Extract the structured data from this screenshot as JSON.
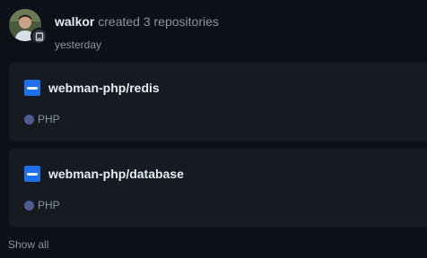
{
  "event": {
    "actor": "walkor",
    "action": "created 3 repositories",
    "timestamp": "yesterday"
  },
  "repos": [
    {
      "name": "webman-php/redis",
      "language": "PHP",
      "language_color": "#4f5d95"
    },
    {
      "name": "webman-php/database",
      "language": "PHP",
      "language_color": "#4f5d95"
    }
  ],
  "footer": {
    "show_all": "Show all"
  },
  "icons": {
    "repo": "repo-icon",
    "badge": "repo-badge-icon"
  },
  "colors": {
    "background": "#0d1117",
    "card": "#161b22",
    "accent": "#1f6feb",
    "muted_text": "#8b949e"
  }
}
